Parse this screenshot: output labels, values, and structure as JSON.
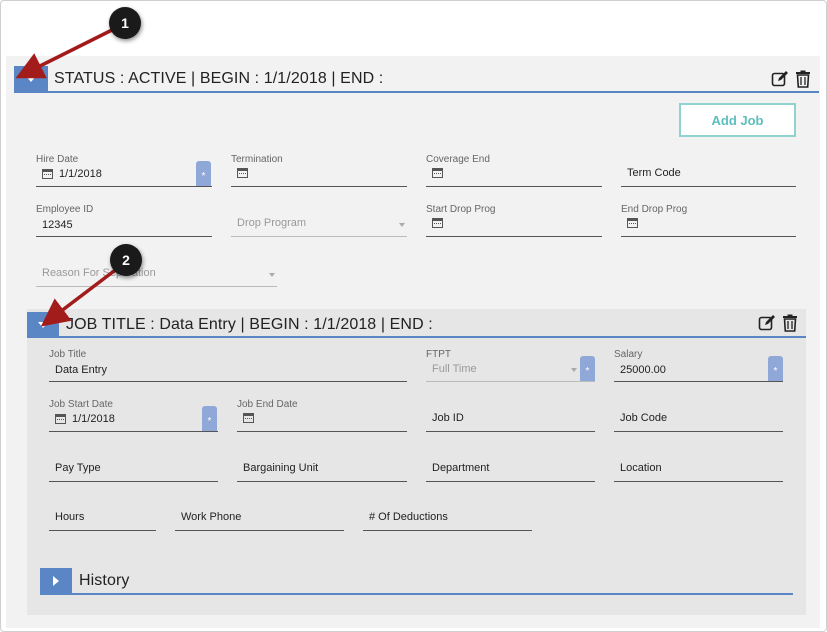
{
  "status_section": {
    "title": "STATUS : ACTIVE | BEGIN : 1/1/2018 | END :",
    "add_job_label": "Add Job",
    "fields": {
      "hire_date": {
        "label": "Hire Date",
        "value": "1/1/2018"
      },
      "termination": {
        "label": "Termination",
        "value": ""
      },
      "coverage_end": {
        "label": "Coverage End",
        "value": ""
      },
      "term_code": {
        "placeholder": "Term Code"
      },
      "employee_id": {
        "label": "Employee ID",
        "value": "12345"
      },
      "drop_program": {
        "placeholder": "Drop Program"
      },
      "start_drop_prog": {
        "label": "Start Drop Prog",
        "value": ""
      },
      "end_drop_prog": {
        "label": "End Drop Prog",
        "value": ""
      },
      "reason_for_separation": {
        "placeholder": "Reason For Separation"
      }
    }
  },
  "job_section": {
    "title": "JOB TITLE : Data Entry | BEGIN : 1/1/2018 | END :",
    "fields": {
      "job_title": {
        "label": "Job Title",
        "value": "Data Entry"
      },
      "ftpt": {
        "label": "FTPT",
        "value": "Full Time"
      },
      "salary": {
        "label": "Salary",
        "value": "25000.00"
      },
      "job_start_date": {
        "label": "Job Start Date",
        "value": "1/1/2018"
      },
      "job_end_date": {
        "label": "Job End Date",
        "value": ""
      },
      "job_id": {
        "placeholder": "Job ID"
      },
      "job_code": {
        "placeholder": "Job Code"
      },
      "pay_type": {
        "placeholder": "Pay Type"
      },
      "bargaining_unit": {
        "placeholder": "Bargaining Unit"
      },
      "department": {
        "placeholder": "Department"
      },
      "location": {
        "placeholder": "Location"
      },
      "hours": {
        "placeholder": "Hours"
      },
      "work_phone": {
        "placeholder": "Work Phone"
      },
      "num_deductions": {
        "placeholder": "# Of Deductions"
      }
    }
  },
  "history_section": {
    "title": "History"
  },
  "required_marker": "*",
  "callouts": [
    "1",
    "2"
  ],
  "colors": {
    "accent": "#5b86c6",
    "add_job": "#5bbfbc",
    "arrow": "#a31c1c"
  }
}
